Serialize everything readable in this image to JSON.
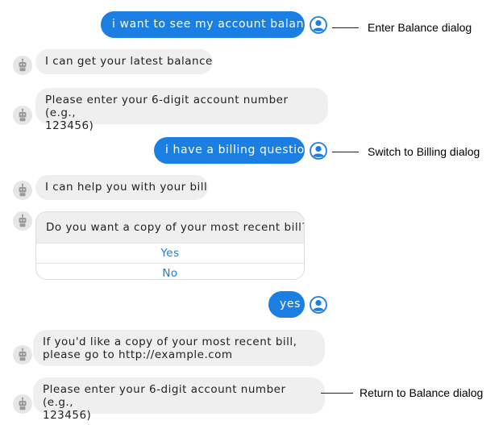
{
  "messages": {
    "user_1": "i want to see my account balance",
    "bot_1": "I can get your latest balance",
    "bot_2": "Please enter your 6-digit account number (e.g.,\n123456)",
    "user_2": "i have a billing question",
    "bot_3": "I can help you with your bill",
    "bot_4_card": {
      "question": "Do you want a copy of your most recent bill?",
      "option_yes": "Yes",
      "option_no": "No"
    },
    "user_3": "yes",
    "bot_5": "If you'd like a copy of your most recent bill,\nplease go to http://example.com",
    "bot_6": "Please enter your 6-digit account number (e.g.,\n123456)"
  },
  "annotations": {
    "enter_balance": "Enter Balance dialog",
    "switch_billing": "Switch to Billing dialog",
    "return_balance": "Return to Balance dialog"
  },
  "colors": {
    "user_bubble": "#1a7ee3",
    "bot_bubble": "#efefef",
    "link_option": "#1a7ee3"
  },
  "icons": {
    "user": "user-avatar-icon",
    "bot": "robot-icon"
  }
}
